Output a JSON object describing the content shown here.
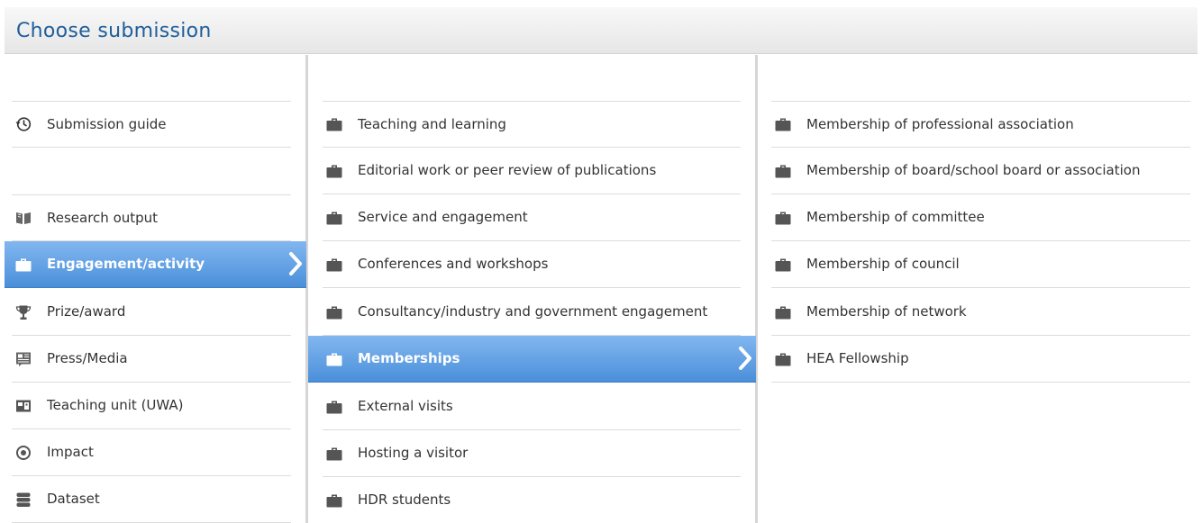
{
  "header": {
    "title": "Choose submission"
  },
  "colors": {
    "title": "#1f5e99",
    "selected_top": "#82b7f0",
    "selected_bottom": "#4a8fda",
    "briefcase": "#555555"
  },
  "column1": {
    "items": [
      {
        "label": "Submission guide",
        "icon": "history-icon"
      },
      {
        "label": "Research output",
        "icon": "book-icon"
      },
      {
        "label": "Engagement/activity",
        "icon": "briefcase-icon",
        "selected": true
      },
      {
        "label": "Prize/award",
        "icon": "trophy-icon"
      },
      {
        "label": "Press/Media",
        "icon": "newspaper-icon"
      },
      {
        "label": "Teaching unit (UWA)",
        "icon": "film-icon"
      },
      {
        "label": "Impact",
        "icon": "target-icon"
      },
      {
        "label": "Dataset",
        "icon": "database-icon"
      }
    ]
  },
  "column2": {
    "items": [
      {
        "label": "Teaching and learning",
        "icon": "briefcase-icon"
      },
      {
        "label": "Editorial work or peer review of publications",
        "icon": "briefcase-icon"
      },
      {
        "label": "Service and engagement",
        "icon": "briefcase-icon"
      },
      {
        "label": "Conferences and workshops",
        "icon": "briefcase-icon"
      },
      {
        "label": "Consultancy/industry and government engagement",
        "icon": "briefcase-icon"
      },
      {
        "label": "Memberships",
        "icon": "briefcase-icon",
        "selected": true
      },
      {
        "label": "External visits",
        "icon": "briefcase-icon"
      },
      {
        "label": "Hosting a visitor",
        "icon": "briefcase-icon"
      },
      {
        "label": "HDR students",
        "icon": "briefcase-icon"
      }
    ]
  },
  "column3": {
    "items": [
      {
        "label": "Membership of professional association",
        "icon": "briefcase-icon"
      },
      {
        "label": "Membership of board/school board or association",
        "icon": "briefcase-icon"
      },
      {
        "label": "Membership of committee",
        "icon": "briefcase-icon"
      },
      {
        "label": "Membership of council",
        "icon": "briefcase-icon"
      },
      {
        "label": "Membership of network",
        "icon": "briefcase-icon"
      },
      {
        "label": "HEA Fellowship",
        "icon": "briefcase-icon"
      }
    ]
  }
}
